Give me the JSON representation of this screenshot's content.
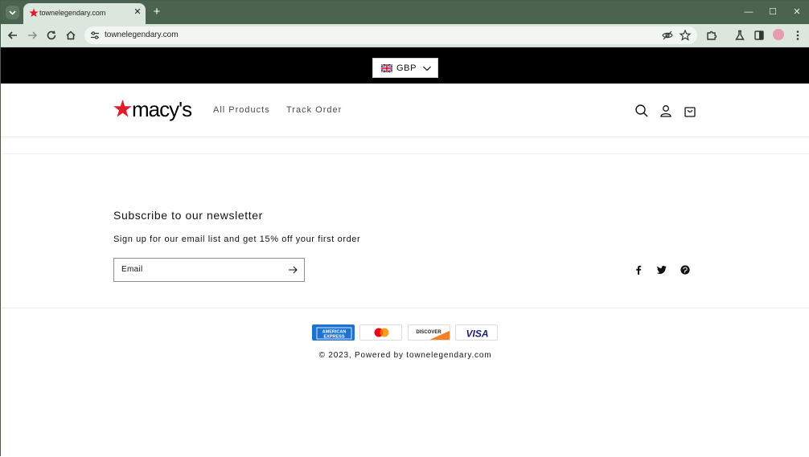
{
  "browser": {
    "tab_title": "townelegendary.com",
    "url": "townelegendary.com",
    "tab_close": "✕",
    "new_tab": "+",
    "minimize": "—",
    "maximize": "☐",
    "close": "✕"
  },
  "announcement": {
    "currency": "GBP"
  },
  "header": {
    "logo_text": "macy's",
    "nav": [
      "All Products",
      "Track Order"
    ]
  },
  "newsletter": {
    "title": "Subscribe to our newsletter",
    "subtitle": "Sign up for our email list and get 15% off your first order",
    "email_placeholder": "Email"
  },
  "payment_methods": {
    "amex": "AMERICAN EXPRESS",
    "discover": "DISCOVER",
    "visa": "VISA"
  },
  "footer": {
    "copyright_prefix": "© 2023, ",
    "powered_by": "Powered by townelegendary.com"
  },
  "colors": {
    "tab_strip": "#4b6450",
    "toolbar": "#dbe6dd",
    "announcement_bar": "#000000",
    "macys_red": "#e21a2c",
    "amex_blue": "#1f72cd",
    "visa_blue": "#1a1f71"
  }
}
